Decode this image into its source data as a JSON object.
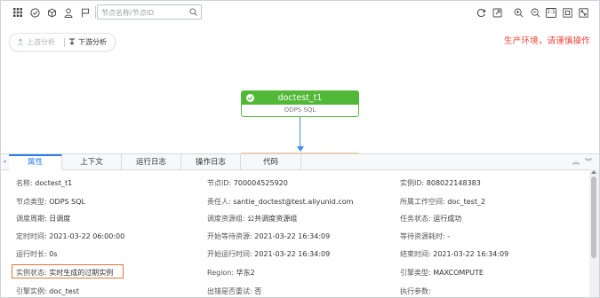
{
  "toolbar": {
    "search_placeholder": "节点名称/节点ID",
    "left_icons": [
      "grid-icon",
      "check-circle-icon",
      "cube-icon",
      "user-icon",
      "flag-icon"
    ],
    "right_icons": [
      "refresh-icon",
      "export-icon",
      "zoom-in-icon",
      "zoom-out-icon",
      "actual-size-icon",
      "fit-icon",
      "fullscreen-icon"
    ],
    "actual_size_label": "1:1"
  },
  "analysis": {
    "upstream_label": "上游分析",
    "downstream_label": "下游分析"
  },
  "warning": "生产环境，请谨慎操作",
  "node": {
    "name": "doctest_t1",
    "type": "ODPS SQL"
  },
  "panel": {
    "tabs": [
      "属性",
      "上下文",
      "运行日志",
      "操作日志",
      "代码"
    ],
    "active_tab": "属性",
    "collapse_label": "«",
    "ctrl_up": "︽",
    "ctrl_down": "︾"
  },
  "properties": {
    "rows": [
      [
        {
          "label": "名称:",
          "value": "doctest_t1"
        },
        {
          "label": "节点ID:",
          "value": "700004525920"
        },
        {
          "label": "实例ID:",
          "value": "808022148383"
        }
      ],
      [
        {
          "label": "节点类型:",
          "value": "ODPS SQL"
        },
        {
          "label": "责任人:",
          "value": "santie_doctest@test.aliyunid.com"
        },
        {
          "label": "所属工作空间:",
          "value": "doc_test_2"
        }
      ],
      [
        {
          "label": "调度周期:",
          "value": "日调度"
        },
        {
          "label": "调度资源组:",
          "value": "公共调度资源组"
        },
        {
          "label": "任务状态:",
          "value": "运行成功"
        }
      ],
      [
        {
          "label": "定时时间:",
          "value": "2021-03-22 06:00:00"
        },
        {
          "label": "开始等待资源:",
          "value": "2021-03-22 16:34:09"
        },
        {
          "label": "等待资源耗时:",
          "value": "-"
        }
      ],
      [
        {
          "label": "运行时长:",
          "value": "0s"
        },
        {
          "label": "开始运行时间:",
          "value": "2021-03-22 16:34:09"
        },
        {
          "label": "结束时间:",
          "value": "2021-03-22 16:34:09"
        }
      ],
      [
        {
          "label": "实例状态:",
          "value": "实时生成的过期实例"
        },
        {
          "label": "Region:",
          "value": "华东2"
        },
        {
          "label": "引擎类型:",
          "value": "MAXCOMPUTE"
        }
      ],
      [
        {
          "label": "引擎实例:",
          "value": "doc_test"
        },
        {
          "label": "出错是否重试:",
          "value": "否"
        },
        {
          "label": "执行参数:",
          "value": ""
        }
      ]
    ]
  },
  "colors": {
    "node_green": "#52b837",
    "accent_blue": "#2e7be2",
    "warning_red": "#f04134",
    "highlight_orange": "#e0773a"
  }
}
